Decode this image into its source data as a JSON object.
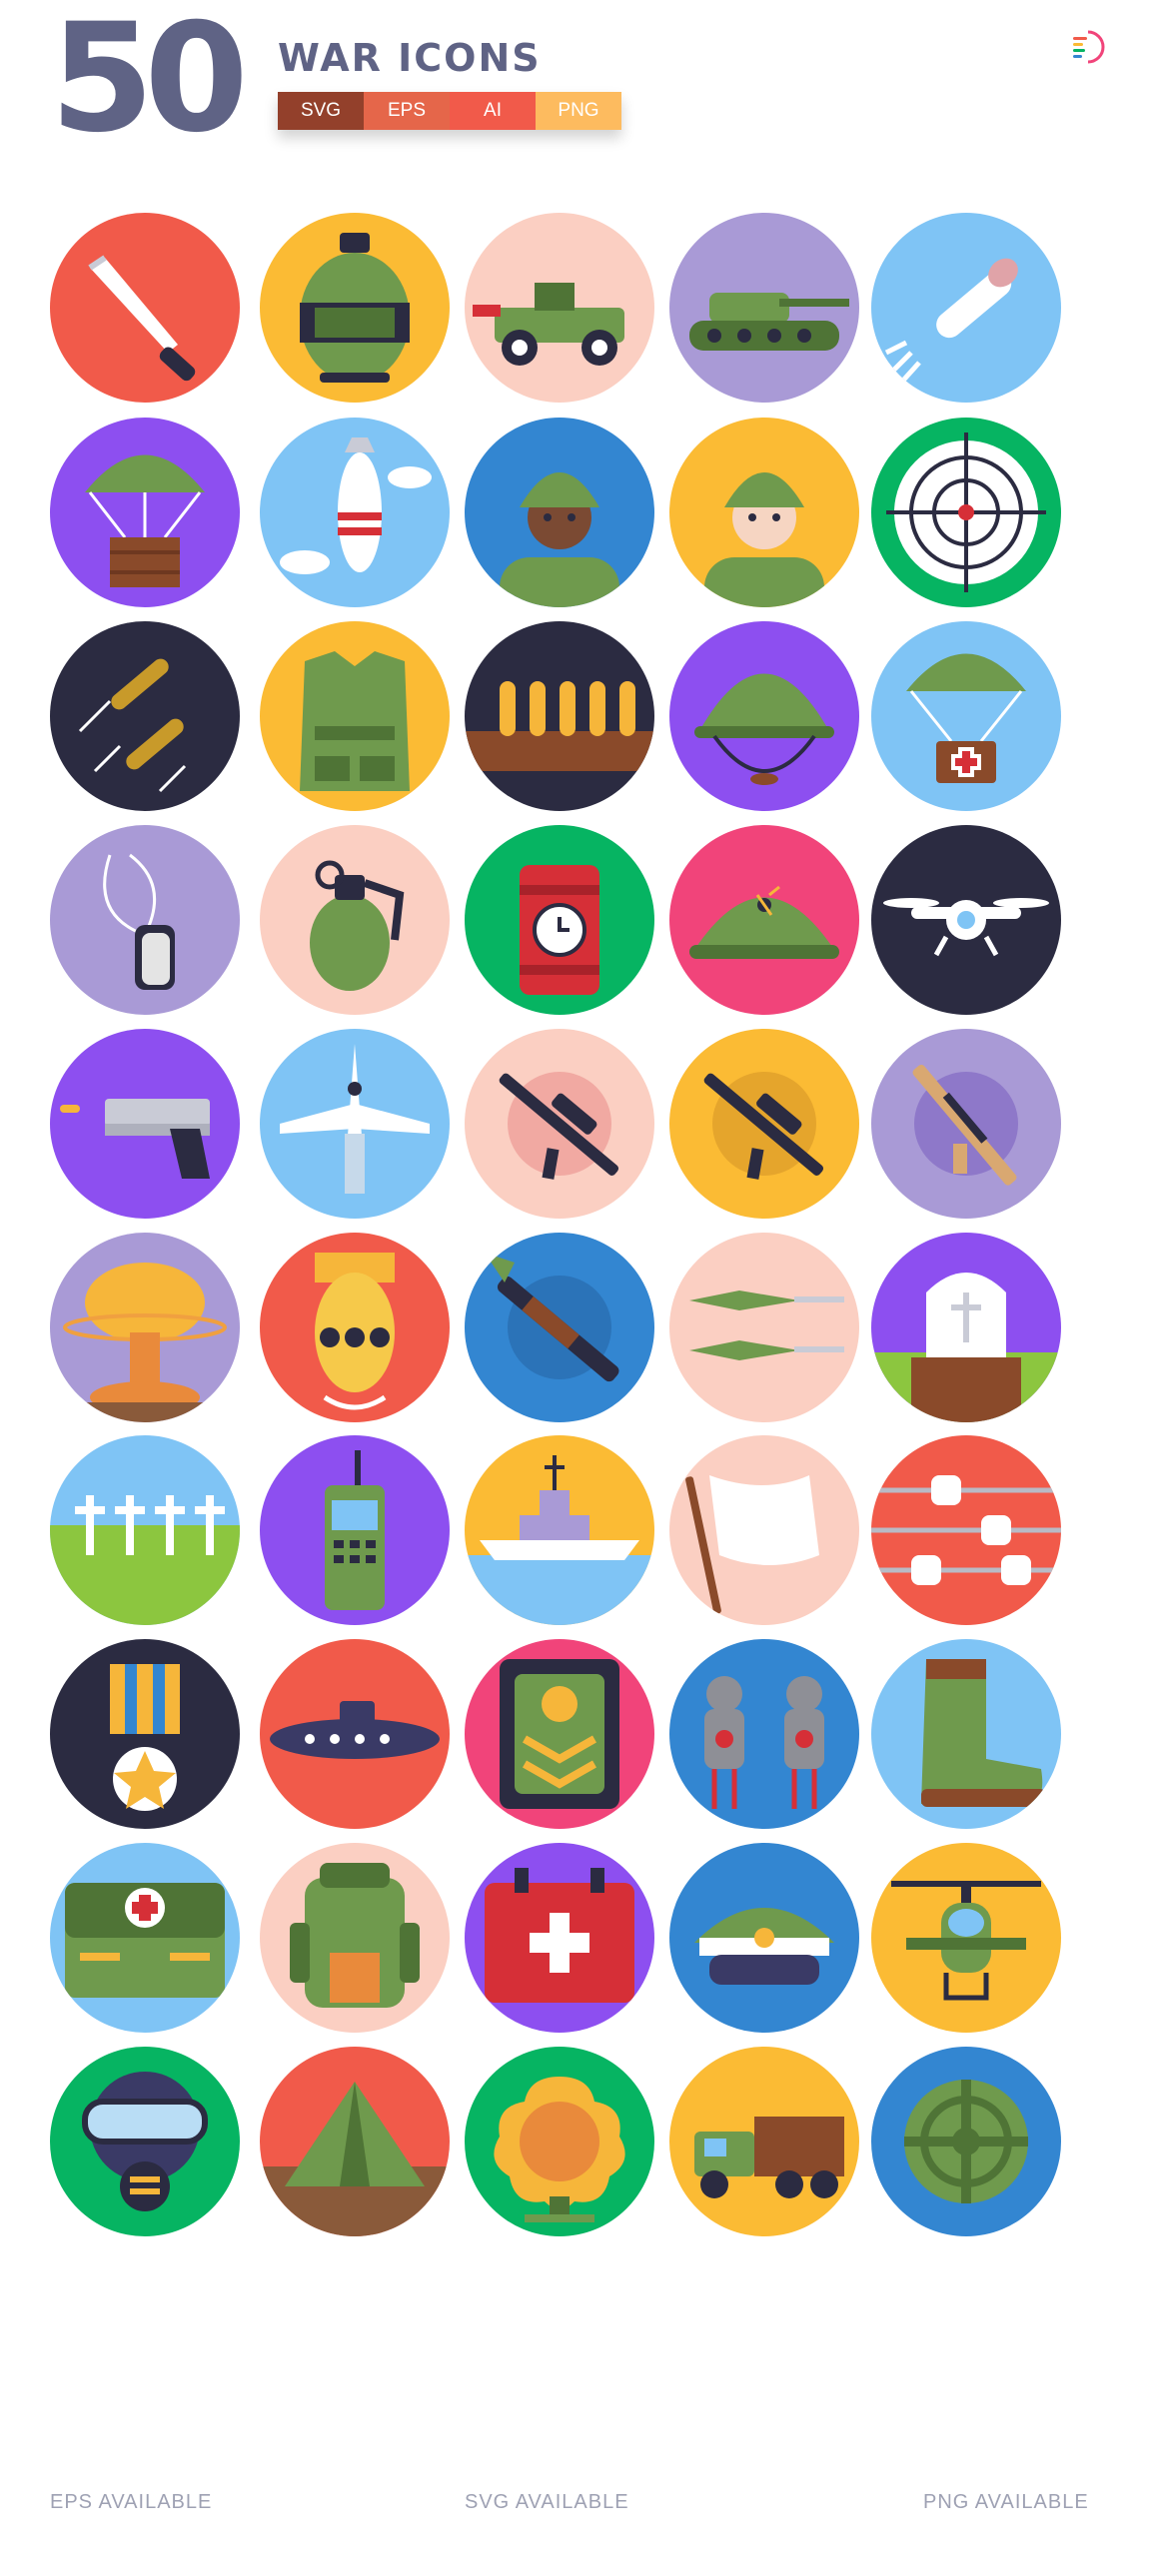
{
  "header": {
    "count": "50",
    "title": "WAR ICONS",
    "formats": [
      {
        "label": "SVG",
        "color": "#93402b"
      },
      {
        "label": "EPS",
        "color": "#e5664a"
      },
      {
        "label": "AI",
        "color": "#f15a4a"
      },
      {
        "label": "PNG",
        "color": "#fdbb5f"
      }
    ]
  },
  "footer": {
    "eps": "EPS AVAILABLE",
    "svg": "SVG AVAILABLE",
    "png": "PNG AVAILABLE"
  },
  "icons": [
    {
      "name": "knife-icon",
      "bg": "#f15a4a",
      "kind": "knife"
    },
    {
      "name": "canteen-icon",
      "bg": "#fbbb34",
      "kind": "canteen"
    },
    {
      "name": "jeep-icon",
      "bg": "#fbcfc2",
      "kind": "jeep"
    },
    {
      "name": "tank-icon",
      "bg": "#a99ad6",
      "kind": "tank"
    },
    {
      "name": "missile-icon",
      "bg": "#7fc4f5",
      "kind": "missile"
    },
    {
      "name": "parachute-crate-icon",
      "bg": "#8d4ff0",
      "kind": "parachute-crate"
    },
    {
      "name": "bomb-icon",
      "bg": "#7fc4f5",
      "kind": "bomb"
    },
    {
      "name": "soldier-male-icon",
      "bg": "#3386d1",
      "kind": "soldier"
    },
    {
      "name": "soldier-female-icon",
      "bg": "#fbbb34",
      "kind": "soldier-light"
    },
    {
      "name": "crosshair-target-icon",
      "bg": "#06b462",
      "kind": "crosshair"
    },
    {
      "name": "bullets-flying-icon",
      "bg": "#2b2b41",
      "kind": "bullets-flying"
    },
    {
      "name": "bulletproof-vest-icon",
      "bg": "#fbbb34",
      "kind": "vest"
    },
    {
      "name": "ammo-belt-icon",
      "bg": "#2b2b41",
      "kind": "ammo-belt"
    },
    {
      "name": "army-helmet-icon",
      "bg": "#8d4ff0",
      "kind": "helmet-strap"
    },
    {
      "name": "parachute-medkit-icon",
      "bg": "#7fc4f5",
      "kind": "parachute-medkit"
    },
    {
      "name": "dog-tag-icon",
      "bg": "#a99ad6",
      "kind": "dog-tag"
    },
    {
      "name": "grenade-icon",
      "bg": "#fbcfc2",
      "kind": "grenade"
    },
    {
      "name": "time-bomb-icon",
      "bg": "#06b462",
      "kind": "dynamite"
    },
    {
      "name": "damaged-helmet-icon",
      "bg": "#f1447a",
      "kind": "helmet"
    },
    {
      "name": "drone-icon",
      "bg": "#2b2b41",
      "kind": "drone"
    },
    {
      "name": "pistol-icon",
      "bg": "#8d4ff0",
      "kind": "pistol"
    },
    {
      "name": "fighter-jet-icon",
      "bg": "#7fc4f5",
      "kind": "jet"
    },
    {
      "name": "machine-gun-icon",
      "bg": "#fbcfc2",
      "kind": "rifle",
      "inner": "#f1a9a2"
    },
    {
      "name": "sniper-rifle-icon",
      "bg": "#fbbb34",
      "kind": "rifle",
      "inner": "#e5a52c"
    },
    {
      "name": "assault-rifle-icon",
      "bg": "#a99ad6",
      "kind": "rifle-tan",
      "inner": "#8e78c9"
    },
    {
      "name": "nuclear-explosion-icon",
      "bg": "#a99ad6",
      "kind": "mushroom"
    },
    {
      "name": "nuke-warhead-icon",
      "bg": "#f15a4a",
      "kind": "warhead"
    },
    {
      "name": "rocket-launcher-icon",
      "bg": "#3386d1",
      "kind": "rpg",
      "inner": "#2b73b8"
    },
    {
      "name": "rpg-rockets-icon",
      "bg": "#fbcfc2",
      "kind": "rockets"
    },
    {
      "name": "grave-icon",
      "bg": "#8d4ff0",
      "kind": "grave"
    },
    {
      "name": "cemetery-icon",
      "bg": "#7fc4f5",
      "kind": "cemetery"
    },
    {
      "name": "radio-icon",
      "bg": "#8d4ff0",
      "kind": "radio"
    },
    {
      "name": "battleship-icon",
      "bg": "#fbbb34",
      "kind": "ship"
    },
    {
      "name": "white-flag-icon",
      "bg": "#fbcfc2",
      "kind": "flag"
    },
    {
      "name": "barbed-wire-icon",
      "bg": "#f15a4a",
      "kind": "barbed-wire"
    },
    {
      "name": "medal-icon",
      "bg": "#2b2b41",
      "kind": "medal"
    },
    {
      "name": "submarine-icon",
      "bg": "#f15a4a",
      "kind": "submarine"
    },
    {
      "name": "rank-insignia-icon",
      "bg": "#f1447a",
      "kind": "insignia"
    },
    {
      "name": "shooting-targets-icon",
      "bg": "#3386d1",
      "kind": "targets"
    },
    {
      "name": "combat-boot-icon",
      "bg": "#7fc4f5",
      "kind": "boot"
    },
    {
      "name": "medic-bag-icon",
      "bg": "#7fc4f5",
      "kind": "medic-bag"
    },
    {
      "name": "backpack-icon",
      "bg": "#fbcfc2",
      "kind": "backpack"
    },
    {
      "name": "first-aid-kit-icon",
      "bg": "#8d4ff0",
      "kind": "first-aid"
    },
    {
      "name": "officer-cap-icon",
      "bg": "#3386d1",
      "kind": "cap"
    },
    {
      "name": "helicopter-icon",
      "bg": "#fbbb34",
      "kind": "helicopter"
    },
    {
      "name": "gas-mask-icon",
      "bg": "#06b462",
      "kind": "gas-mask"
    },
    {
      "name": "tent-icon",
      "bg": "#f15a4a",
      "kind": "tent"
    },
    {
      "name": "explosion-icon",
      "bg": "#06b462",
      "kind": "explosion"
    },
    {
      "name": "military-truck-icon",
      "bg": "#fbbb34",
      "kind": "truck"
    },
    {
      "name": "landmine-icon",
      "bg": "#3386d1",
      "kind": "landmine"
    }
  ]
}
